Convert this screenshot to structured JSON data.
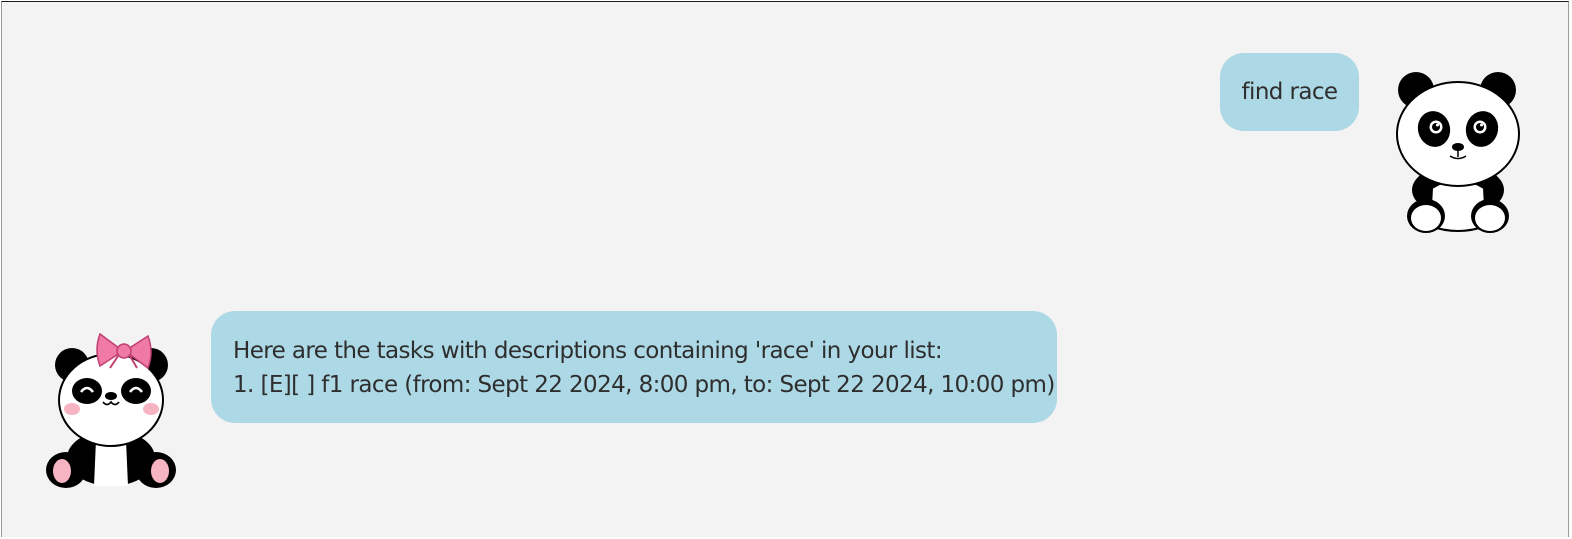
{
  "chat": {
    "messages": [
      {
        "sender": "user",
        "avatar_icon": "panda-icon",
        "lines": [
          "find race"
        ]
      },
      {
        "sender": "bot",
        "avatar_icon": "panda-with-bow-icon",
        "lines": [
          "Here are the tasks with descriptions containing 'race' in your list:",
          "1. [E][ ] f1 race (from: Sept 22 2024, 8:00 pm, to: Sept 22 2024, 10:00 pm)"
        ]
      }
    ]
  },
  "colors": {
    "background": "#f3f3f3",
    "bubble": "#add8e6",
    "text": "#2e2e2e",
    "bow": "#f07aa6",
    "cheek": "#f6b3c2"
  }
}
